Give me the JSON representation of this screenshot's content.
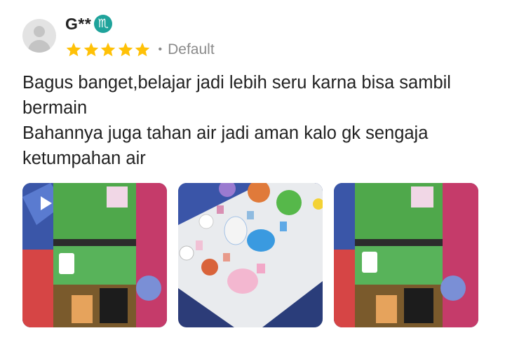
{
  "review": {
    "username": "G**",
    "zodiac_symbol": "♏",
    "rating": 5,
    "variant": "Default",
    "text_lines": [
      "Bagus banget,belajar jadi lebih seru karna bisa sambil bermain",
      "Bahannya juga tahan air jadi aman kalo gk sengaja ketumpahan air"
    ]
  },
  "media": [
    {
      "kind": "video",
      "play_icon": "play-icon"
    },
    {
      "kind": "photo"
    },
    {
      "kind": "photo"
    }
  ],
  "colors": {
    "star": "#FFC107",
    "zodiac_badge": "#1FA39B",
    "muted_text": "#8A8A8A"
  }
}
